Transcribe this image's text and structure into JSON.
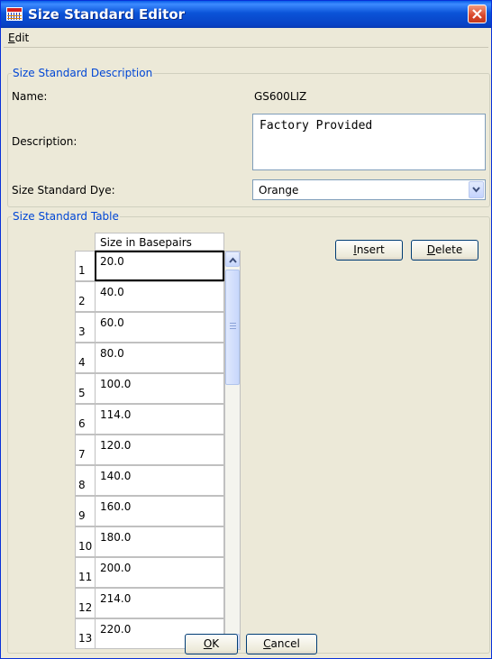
{
  "window": {
    "title": "Size Standard Editor",
    "icon": "ladder-app-icon",
    "close_icon": "close-icon"
  },
  "menu": {
    "edit_pre": "",
    "edit_mnemonic": "E",
    "edit_post": "dit"
  },
  "description_group": {
    "legend": "Size Standard Description",
    "name_label": "Name:",
    "name_value": "GS600LIZ",
    "description_label": "Description:",
    "description_value": "Factory Provided",
    "dye_label": "Size Standard Dye:",
    "dye_value": "Orange"
  },
  "table_group": {
    "legend": "Size Standard Table",
    "column_header": "Size in Basepairs",
    "rows": [
      {
        "num": "1",
        "value": "20.0"
      },
      {
        "num": "2",
        "value": "40.0"
      },
      {
        "num": "3",
        "value": "60.0"
      },
      {
        "num": "4",
        "value": "80.0"
      },
      {
        "num": "5",
        "value": "100.0"
      },
      {
        "num": "6",
        "value": "114.0"
      },
      {
        "num": "7",
        "value": "120.0"
      },
      {
        "num": "8",
        "value": "140.0"
      },
      {
        "num": "9",
        "value": "160.0"
      },
      {
        "num": "10",
        "value": "180.0"
      },
      {
        "num": "11",
        "value": "200.0"
      },
      {
        "num": "12",
        "value": "214.0"
      },
      {
        "num": "13",
        "value": "220.0"
      }
    ],
    "insert": {
      "mnemonic": "I",
      "rest": "nsert"
    },
    "delete": {
      "mnemonic": "D",
      "rest": "elete"
    }
  },
  "footer": {
    "ok": {
      "mnemonic": "O",
      "rest": "K"
    },
    "cancel": {
      "mnemonic": "C",
      "rest": "ancel"
    }
  }
}
